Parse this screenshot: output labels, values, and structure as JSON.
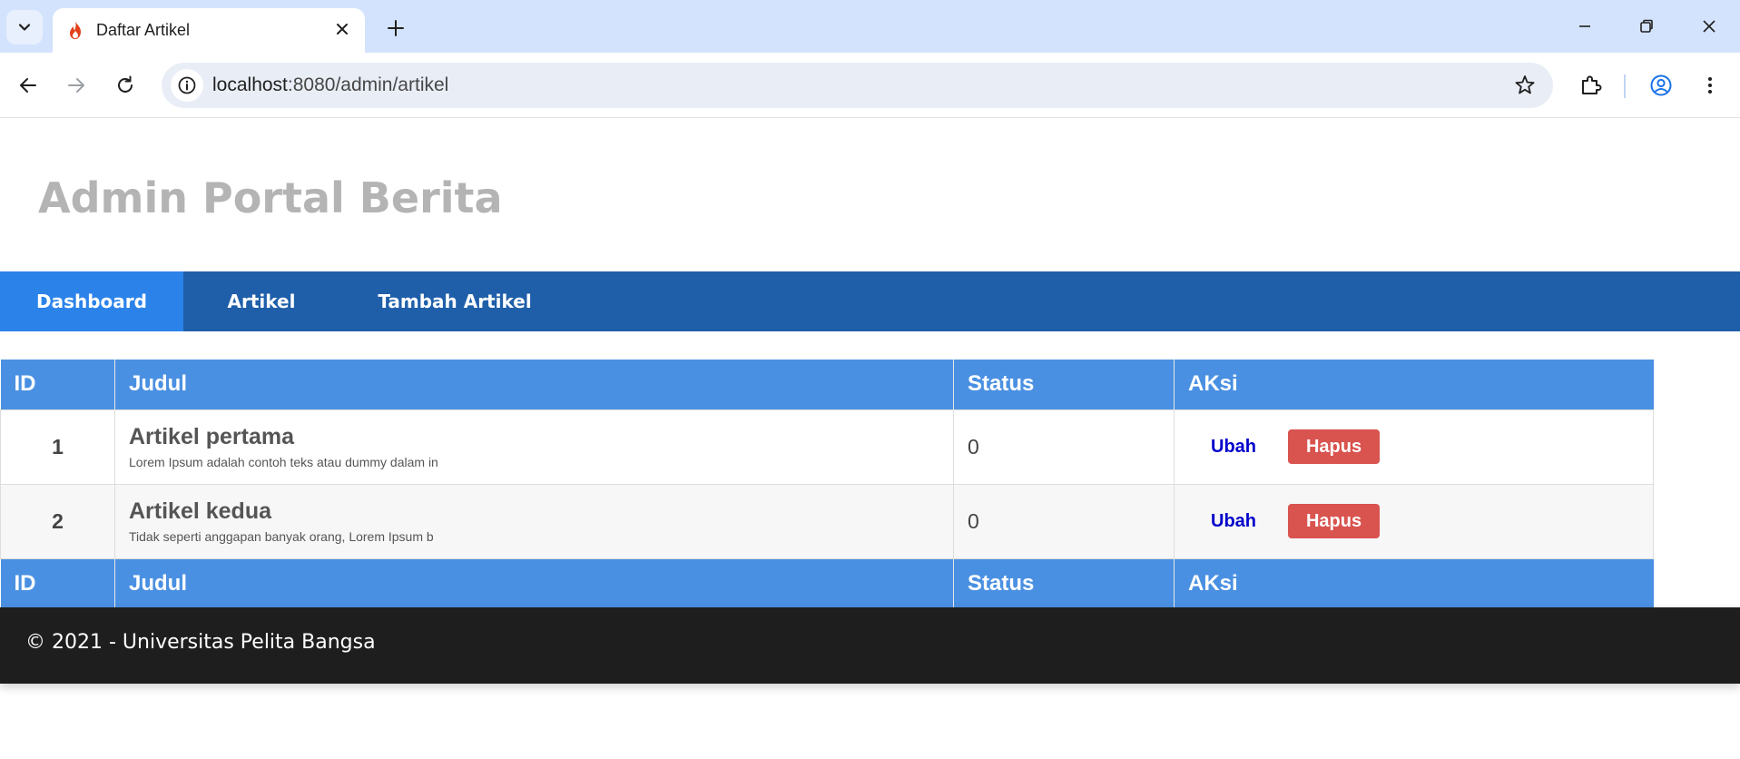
{
  "browser": {
    "tab_title": "Daftar Artikel",
    "url_host": "localhost",
    "url_rest": ":8080/admin/artikel",
    "icons": {
      "tab_search": "chevron-down-icon",
      "favicon": "flame-icon",
      "tab_close": "close-icon",
      "new_tab": "plus-icon",
      "back": "arrow-left-icon",
      "forward": "arrow-right-icon",
      "reload": "reload-icon",
      "site_info": "info-icon",
      "bookmark": "star-icon",
      "extensions": "puzzle-icon",
      "profile": "account-circle-icon",
      "menu": "kebab-menu-icon"
    },
    "colors": {
      "tabbar": "#d3e3fd",
      "omnibox": "#e9eef6",
      "favicon": "#e2401c"
    }
  },
  "header": {
    "title": "Admin Portal Berita"
  },
  "nav": {
    "items": [
      {
        "label": "Dashboard",
        "active": true
      },
      {
        "label": "Artikel",
        "active": false
      },
      {
        "label": "Tambah Artikel",
        "active": false
      }
    ]
  },
  "table": {
    "headers": {
      "id": "ID",
      "judul": "Judul",
      "status": "Status",
      "aksi": "AKsi"
    },
    "rows": [
      {
        "id": "1",
        "title": "Artikel pertama",
        "excerpt": "Lorem Ipsum adalah contoh teks atau dummy dalam in",
        "status": "0",
        "edit_label": "Ubah",
        "delete_label": "Hapus"
      },
      {
        "id": "2",
        "title": "Artikel kedua",
        "excerpt": "Tidak seperti anggapan banyak orang, Lorem Ipsum b",
        "status": "0",
        "edit_label": "Ubah",
        "delete_label": "Hapus"
      }
    ]
  },
  "footer": {
    "text": "© 2021 - Universitas Pelita Bangsa"
  },
  "colors": {
    "nav_bg": "#1f5faa",
    "nav_active": "#2b83ea",
    "table_header": "#4a90e2",
    "delete_button": "#d9534f",
    "edit_link": "#0000cc",
    "footer_bg": "#1e1e1e",
    "title": "#b4b4b4"
  }
}
